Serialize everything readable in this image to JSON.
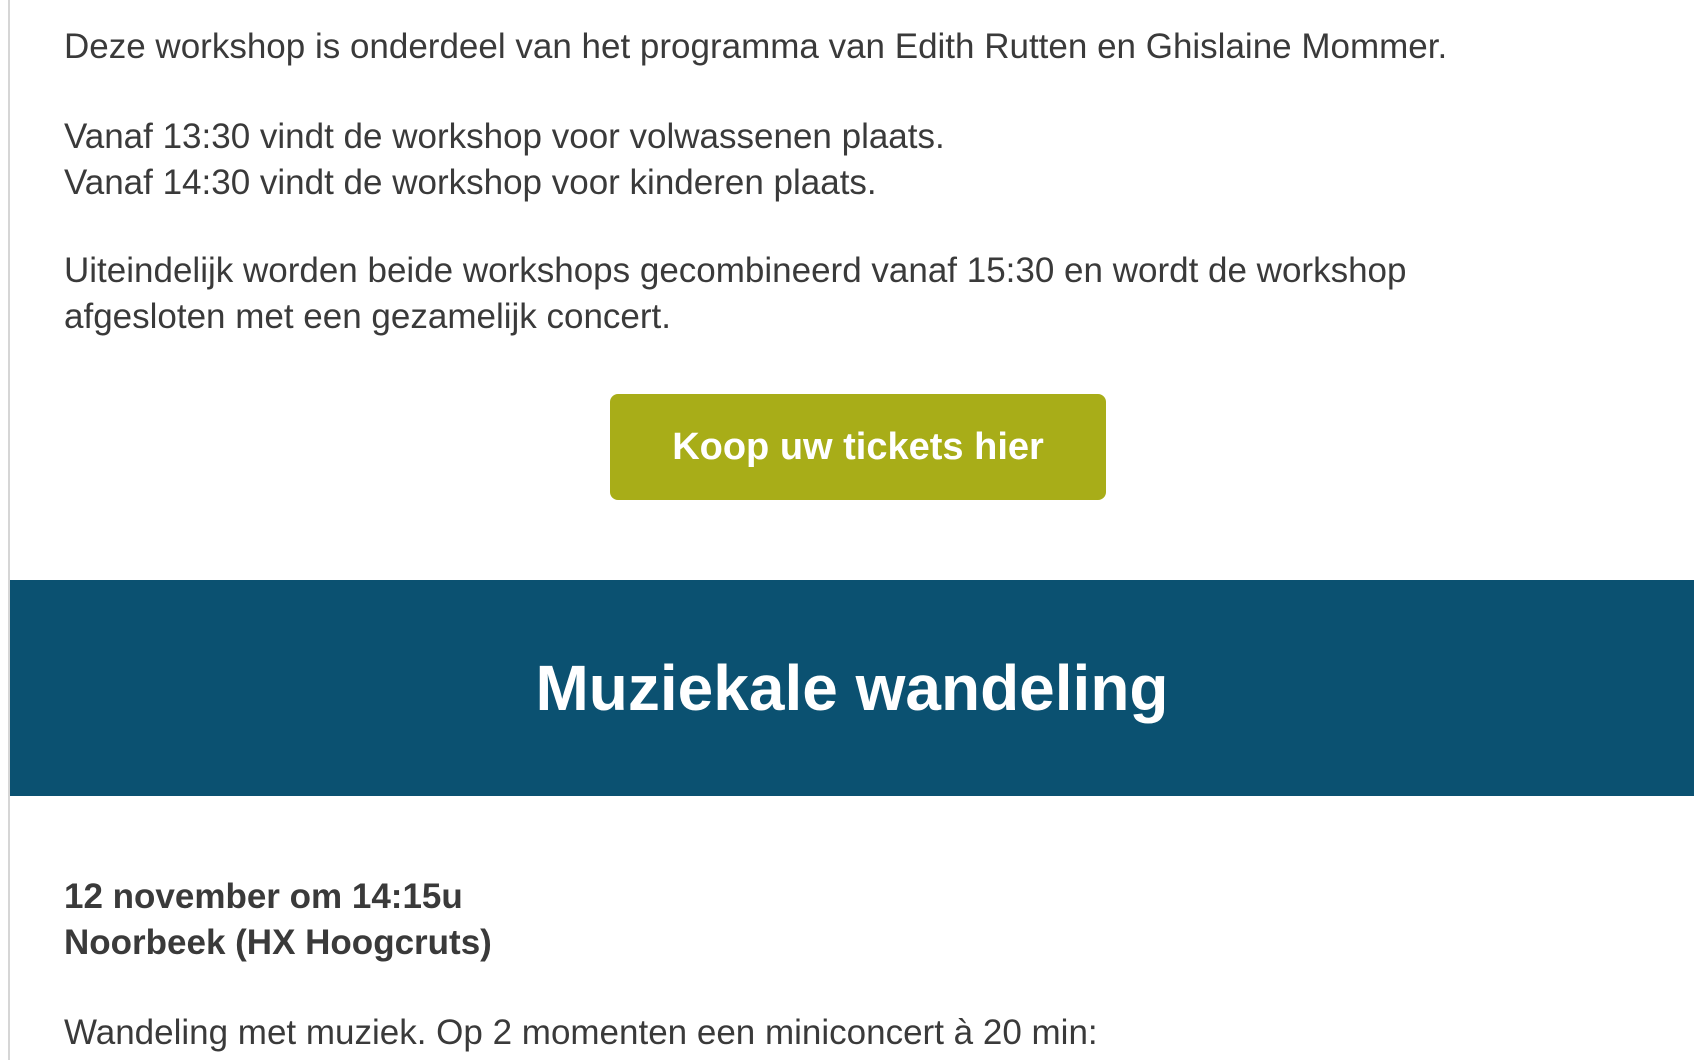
{
  "intro": {
    "line1": "Deze workshop is onderdeel van het programma van Edith Rutten en Ghislaine Mommer.",
    "schedule_line1": "Vanaf 13:30 vindt de workshop voor volwassenen plaats.",
    "schedule_line2": "Vanaf 14:30 vindt de workshop voor kinderen plaats.",
    "combined_line1": "Uiteindelijk worden beide workshops gecombineerd vanaf 15:30 en wordt de workshop",
    "combined_line2": "afgesloten met een gezamelijk concert."
  },
  "cta": {
    "label": "Koop uw tickets hier",
    "color": "#a8ad18"
  },
  "section": {
    "title": "Muziekale wandeling",
    "banner_color": "#0b5171",
    "date_line": "12 november om 14:15u",
    "location_line": "Noorbeek (HX Hoogcruts)",
    "description": "Wandeling met muziek. Op 2 momenten een miniconcert à 20 min:"
  }
}
